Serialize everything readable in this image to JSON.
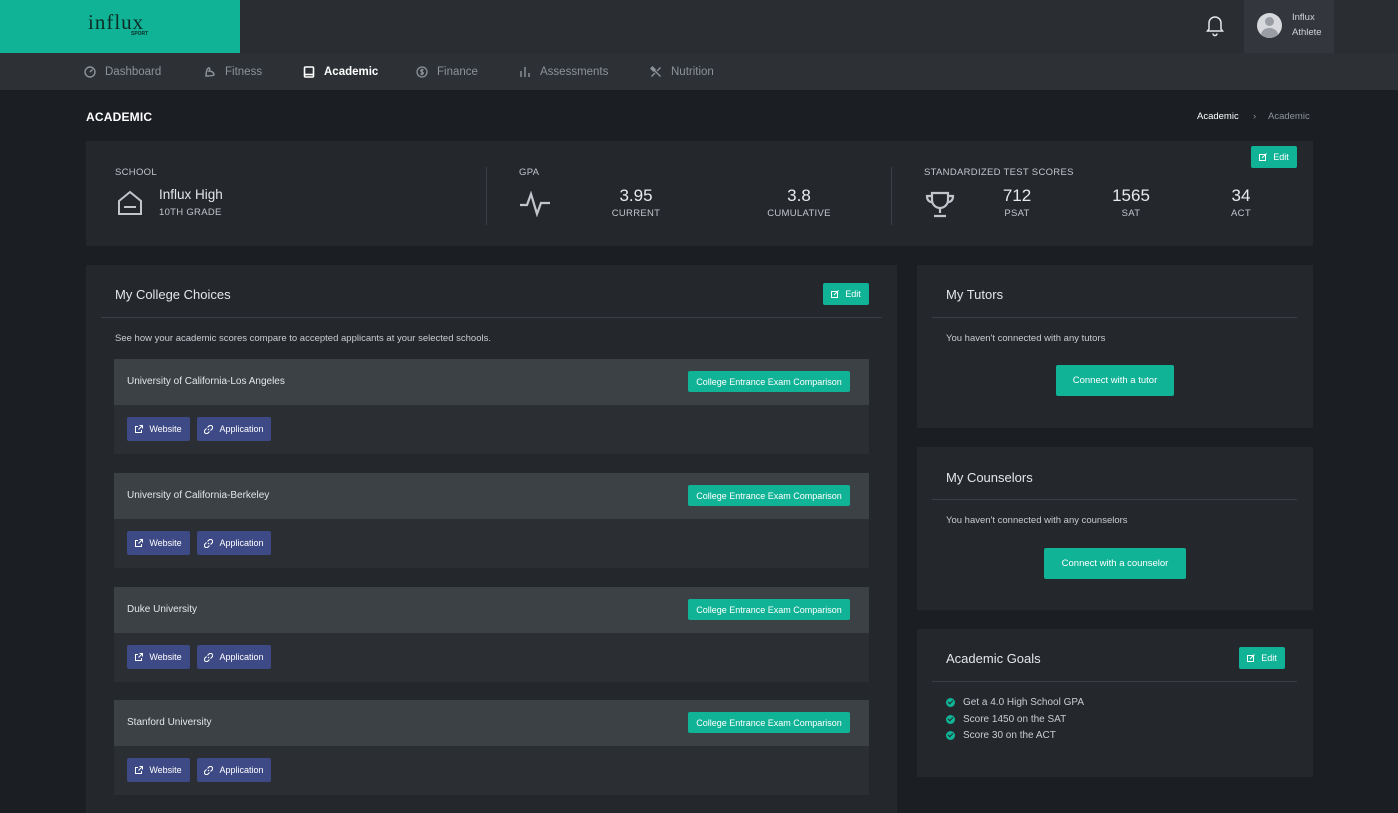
{
  "brand": {
    "logo_text": "influx",
    "logo_sub": "SPORT"
  },
  "user": {
    "name": "Influx",
    "role": "Athlete"
  },
  "nav": [
    {
      "label": "Dashboard",
      "icon": "gauge-icon"
    },
    {
      "label": "Fitness",
      "icon": "muscle-icon"
    },
    {
      "label": "Academic",
      "icon": "book-icon",
      "active": true
    },
    {
      "label": "Finance",
      "icon": "dollar-coin-icon"
    },
    {
      "label": "Assessments",
      "icon": "bar-chart-icon"
    },
    {
      "label": "Nutrition",
      "icon": "utensils-icon"
    }
  ],
  "page": {
    "title": "ACADEMIC",
    "breadcrumb": [
      "Academic",
      "Academic"
    ],
    "breadcrumb_sep": "›"
  },
  "stats": {
    "edit_label": "Edit",
    "school": {
      "label": "SCHOOL",
      "name": "Influx High",
      "grade": "10TH GRADE"
    },
    "gpa": {
      "label": "GPA",
      "current": "3.95",
      "current_label": "CURRENT",
      "cumulative": "3.8",
      "cumulative_label": "CUMULATIVE"
    },
    "tests": {
      "label": "STANDARDIZED TEST SCORES",
      "psat": "712",
      "psat_label": "PSAT",
      "sat": "1565",
      "sat_label": "SAT",
      "act": "34",
      "act_label": "ACT"
    }
  },
  "colleges": {
    "title": "My College Choices",
    "edit_label": "Edit",
    "description": "See how your academic scores compare to accepted applicants at your selected schools.",
    "compare_label": "College Entrance Exam Comparison",
    "website_label": "Website",
    "application_label": "Application",
    "items": [
      {
        "name": "University of California-Los Angeles"
      },
      {
        "name": "University of California-Berkeley"
      },
      {
        "name": "Duke University"
      },
      {
        "name": "Stanford University"
      }
    ]
  },
  "tutors": {
    "title": "My Tutors",
    "empty": "You haven't connected with any tutors",
    "button": "Connect with a tutor"
  },
  "counselors": {
    "title": "My Counselors",
    "empty": "You haven't connected with any counselors",
    "button": "Connect with a counselor"
  },
  "goals": {
    "title": "Academic Goals",
    "edit_label": "Edit",
    "items": [
      "Get a 4.0 High School GPA",
      "Score 1450 on the SAT",
      "Score 30 on the ACT"
    ]
  },
  "colors": {
    "accent": "#10b396",
    "link_button": "#3d4a85",
    "background": "#1b1e22",
    "card": "#24282d"
  }
}
